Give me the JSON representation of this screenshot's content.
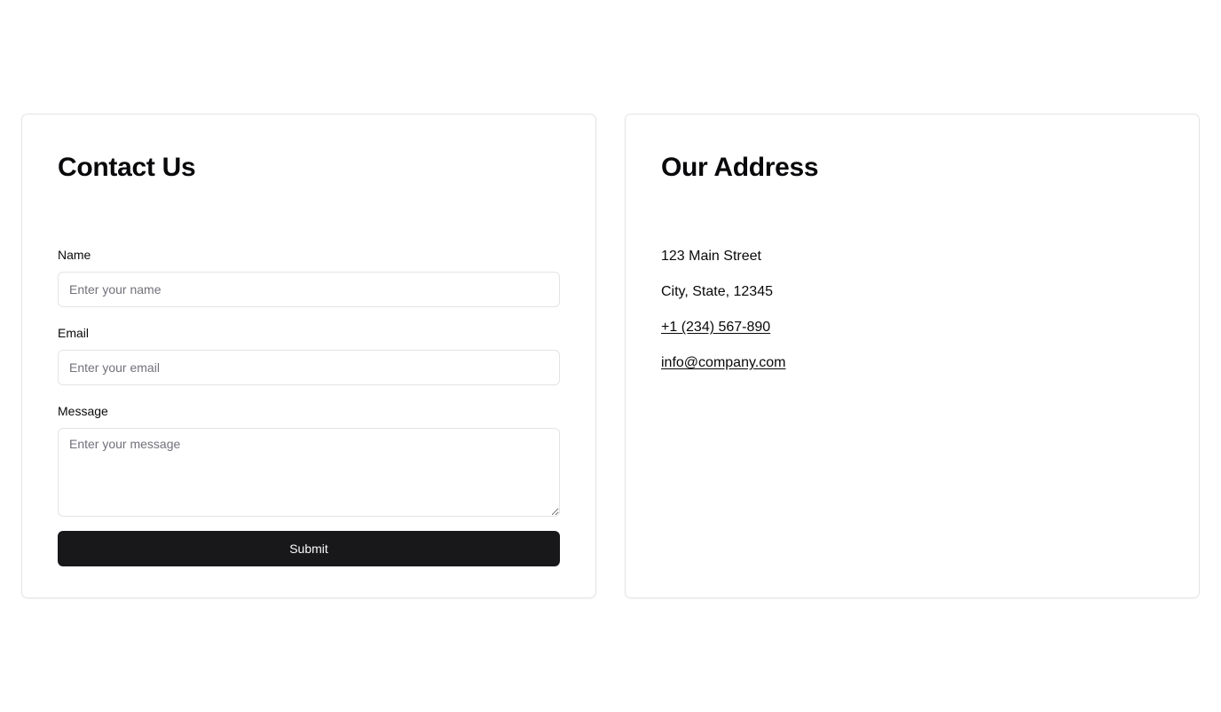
{
  "contact": {
    "title": "Contact Us",
    "name_label": "Name",
    "name_placeholder": "Enter your name",
    "name_value": "",
    "email_label": "Email",
    "email_placeholder": "Enter your email",
    "email_value": "",
    "message_label": "Message",
    "message_placeholder": "Enter your message",
    "message_value": "",
    "submit_label": "Submit"
  },
  "address": {
    "title": "Our Address",
    "street": "123 Main Street",
    "city_line": "City, State, 12345",
    "phone": "+1 (234) 567-890",
    "email": "info@company.com"
  },
  "colors": {
    "button_bg": "#18181b",
    "border": "#e4e4e7",
    "placeholder": "#71717a",
    "text": "#09090b"
  }
}
